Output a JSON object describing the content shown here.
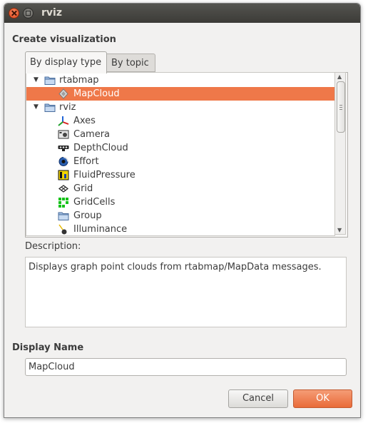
{
  "window": {
    "title": "rviz"
  },
  "create_label": "Create visualization",
  "tabs": [
    {
      "label": "By display type",
      "active": true
    },
    {
      "label": "By topic",
      "active": false
    }
  ],
  "tree": {
    "groups": [
      {
        "label": "rtabmap",
        "expanded": true,
        "icon": "folder-icon",
        "items": [
          {
            "label": "MapCloud",
            "icon": "mapcloud-icon",
            "selected": true
          }
        ]
      },
      {
        "label": "rviz",
        "expanded": true,
        "icon": "folder-icon",
        "items": [
          {
            "label": "Axes",
            "icon": "axes-icon"
          },
          {
            "label": "Camera",
            "icon": "camera-icon"
          },
          {
            "label": "DepthCloud",
            "icon": "depthcloud-icon"
          },
          {
            "label": "Effort",
            "icon": "effort-icon"
          },
          {
            "label": "FluidPressure",
            "icon": "fluidpressure-icon"
          },
          {
            "label": "Grid",
            "icon": "grid-icon"
          },
          {
            "label": "GridCells",
            "icon": "gridcells-icon"
          },
          {
            "label": "Group",
            "icon": "folder-icon"
          },
          {
            "label": "Illuminance",
            "icon": "illuminance-icon"
          }
        ]
      }
    ]
  },
  "description": {
    "label": "Description:",
    "text": "Displays graph point clouds from rtabmap/MapData messages."
  },
  "display_name": {
    "label": "Display Name",
    "value": "MapCloud"
  },
  "buttons": {
    "cancel": "Cancel",
    "ok": "OK"
  },
  "colors": {
    "accent": "#ef7849",
    "titlebar": "#3c3b37"
  }
}
